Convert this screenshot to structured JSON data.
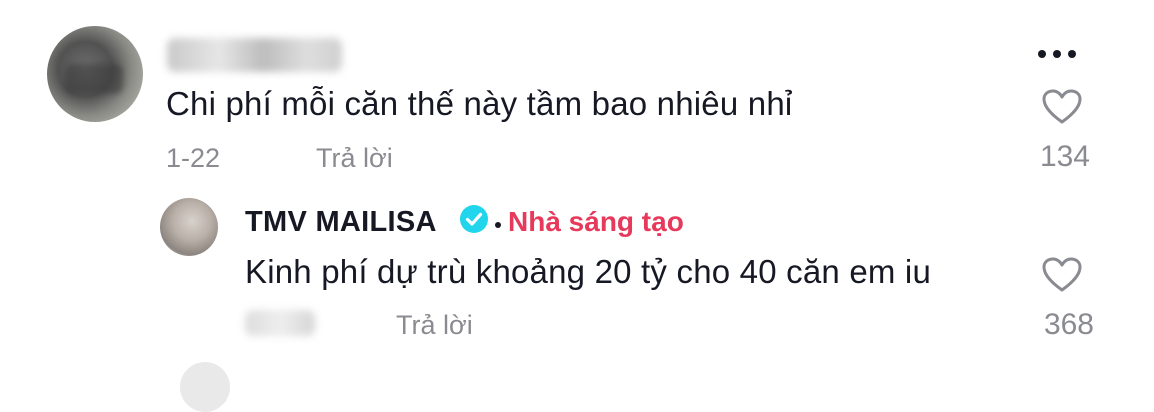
{
  "comment": {
    "text": "Chi phí mỗi căn thế này tầm bao nhiêu nhỉ",
    "date": "1-22",
    "reply_label": "Trả lời",
    "like_count": "134"
  },
  "reply": {
    "author": "TMV MAILISA",
    "creator_label": "Nhà sáng tạo",
    "text": "Kinh phí dự trù khoảng 20 tỷ cho 40 căn em iu",
    "reply_label": "Trả lời",
    "like_count": "368"
  },
  "icons": {
    "more": "more-options-icon",
    "like": "heart-outline-icon",
    "verified": "verified-badge-icon"
  },
  "colors": {
    "creator_accent": "#e6395b",
    "verified_blue": "#20d5ec",
    "meta_gray": "#8a8b91"
  }
}
